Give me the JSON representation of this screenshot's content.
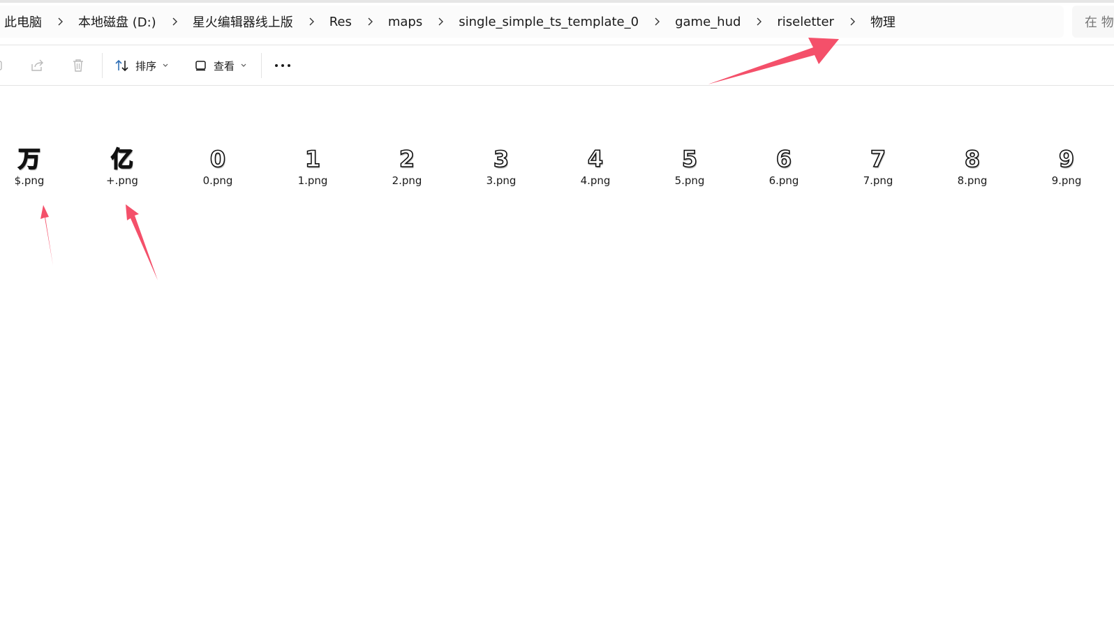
{
  "breadcrumb": {
    "items": [
      "此电脑",
      "本地磁盘 (D:)",
      "星火编辑器线上版",
      "Res",
      "maps",
      "single_simple_ts_template_0",
      "game_hud",
      "riseletter",
      "物理"
    ]
  },
  "search": {
    "placeholder": "在 物"
  },
  "toolbar": {
    "sort_label": "排序",
    "view_label": "查看"
  },
  "files": [
    {
      "glyph": "万",
      "name": "$.png"
    },
    {
      "glyph": "亿",
      "name": "+.png"
    },
    {
      "glyph": "0",
      "name": "0.png"
    },
    {
      "glyph": "1",
      "name": "1.png"
    },
    {
      "glyph": "2",
      "name": "2.png"
    },
    {
      "glyph": "3",
      "name": "3.png"
    },
    {
      "glyph": "4",
      "name": "4.png"
    },
    {
      "glyph": "5",
      "name": "5.png"
    },
    {
      "glyph": "6",
      "name": "6.png"
    },
    {
      "glyph": "7",
      "name": "7.png"
    },
    {
      "glyph": "8",
      "name": "8.png"
    },
    {
      "glyph": "9",
      "name": "9.png"
    }
  ],
  "colors": {
    "annotation_arrow": "#f4506a",
    "toolbar_icon": "#2f6fb6",
    "disabled_icon": "#b9b9b9"
  },
  "icons": {
    "breadcrumb_separator": "chevron-right-icon",
    "share": "share-icon",
    "delete": "trash-icon",
    "sort": "sort-arrows-icon",
    "view": "view-layout-icon",
    "more": "more-horizontal-icon"
  }
}
